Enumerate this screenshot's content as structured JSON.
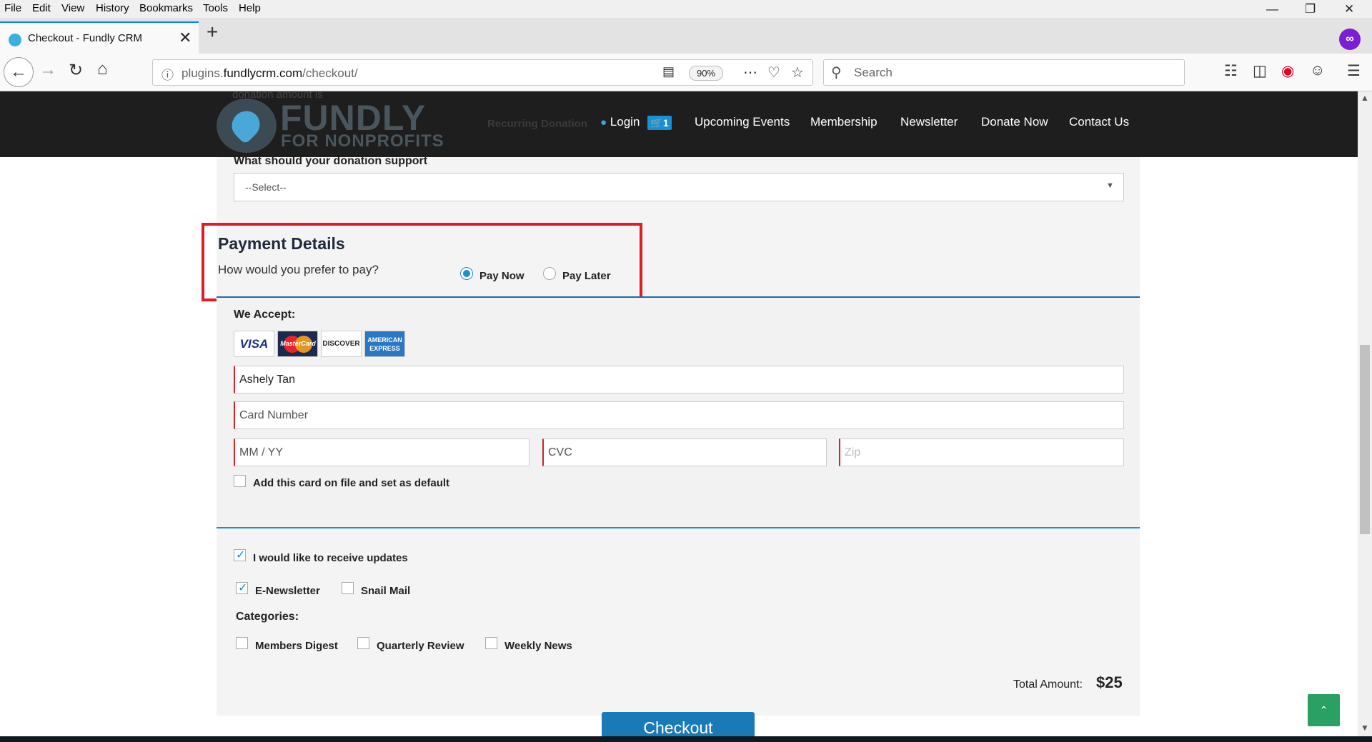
{
  "menu": [
    "File",
    "Edit",
    "View",
    "History",
    "Bookmarks",
    "Tools",
    "Help"
  ],
  "tab": {
    "title": "Checkout - Fundly CRM"
  },
  "address": {
    "prefix": "plugins.",
    "domain": "fundlycrm.com",
    "path": "/checkout/",
    "zoom": "90%"
  },
  "search": {
    "placeholder": "Search"
  },
  "header": {
    "ghost_top": "donation amount is",
    "ghost_recurring": "Recurring Donation",
    "logo_word": "FUNDLY",
    "logo_sub": "FOR NONPROFITS",
    "login": "Login",
    "cart_count": "1",
    "nav": [
      "Upcoming Events",
      "Membership",
      "Newsletter",
      "Donate Now",
      "Contact Us"
    ]
  },
  "donation": {
    "support_label": "What should your donation support",
    "support_selected": "--Select--"
  },
  "payment": {
    "title": "Payment Details",
    "prompt": "How would you prefer to pay?",
    "options": [
      "Pay Now",
      "Pay Later"
    ],
    "selected": "Pay Now",
    "we_accept": "We Accept:",
    "cards": [
      "VISA",
      "MasterCard",
      "DISCOVER",
      "AMERICAN EXPRESS"
    ],
    "name_value": "Ashely Tan",
    "card_number_placeholder": "Card Number",
    "expiry_placeholder": "MM / YY",
    "cvc_placeholder": "CVC",
    "zip_placeholder": "Zip",
    "save_card_label": "Add this card on file and set as default"
  },
  "updates": {
    "receive_label": "I would like to receive updates",
    "channels": [
      {
        "label": "E-Newsletter",
        "checked": true
      },
      {
        "label": "Snail Mail",
        "checked": false
      }
    ],
    "categories_label": "Categories:",
    "categories": [
      {
        "label": "Members Digest",
        "checked": false
      },
      {
        "label": "Quarterly Review",
        "checked": false
      },
      {
        "label": "Weekly News",
        "checked": false
      }
    ]
  },
  "total": {
    "label": "Total Amount:",
    "value": "$25"
  },
  "checkout_label": "Checkout",
  "colors": {
    "brand_blue": "#1a7ab8",
    "highlight_red": "#e21b26",
    "header_bg": "#1e1e1e",
    "to_top_green": "#2aa062"
  }
}
